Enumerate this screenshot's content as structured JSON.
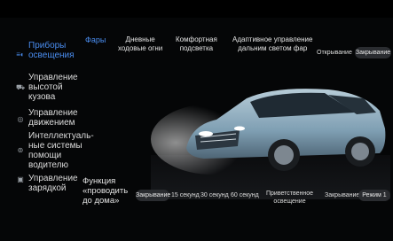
{
  "sidebar": {
    "items": [
      {
        "label_lines": [
          "Приборы",
          "освещения"
        ],
        "icon": "headlight-icon",
        "active": true
      },
      {
        "label_lines": [
          "Управление",
          "высотой",
          "кузова"
        ],
        "icon": "car-height-icon",
        "active": false
      },
      {
        "label_lines": [
          "Управление",
          "движением"
        ],
        "icon": "steering-wheel-icon",
        "active": false
      },
      {
        "label_lines": [
          "Интеллектуаль-",
          "ные системы",
          "помощи",
          "водителю"
        ],
        "icon": "driver-assist-icon",
        "active": false
      },
      {
        "label_lines": [
          "Управление",
          "зарядкой"
        ],
        "icon": "charging-icon",
        "active": false
      }
    ]
  },
  "tabs": {
    "lights": "Фары",
    "drl": {
      "l1": "Дневные",
      "l2": "ходовые огни"
    },
    "comfort": {
      "l1": "Комфортная",
      "l2": "подсветка"
    },
    "adaptive": {
      "l1": "Адаптивное управление",
      "l2": "дальним светом фар"
    }
  },
  "top_options": {
    "open": "Открывание",
    "close": "Закрывание"
  },
  "follow_me_home": {
    "label_lines": [
      "Функция",
      "«проводить",
      "до дома»"
    ],
    "selected": "Закрывание",
    "options": [
      "15 секунд",
      "30 секунд",
      "60 секунд"
    ]
  },
  "welcome": {
    "l1": "Приветственное",
    "l2": "освещение",
    "close": "Закрывание",
    "mode": "Режим 1"
  },
  "colors": {
    "accent": "#4a8df0",
    "car_body": "#8fb0c4"
  }
}
